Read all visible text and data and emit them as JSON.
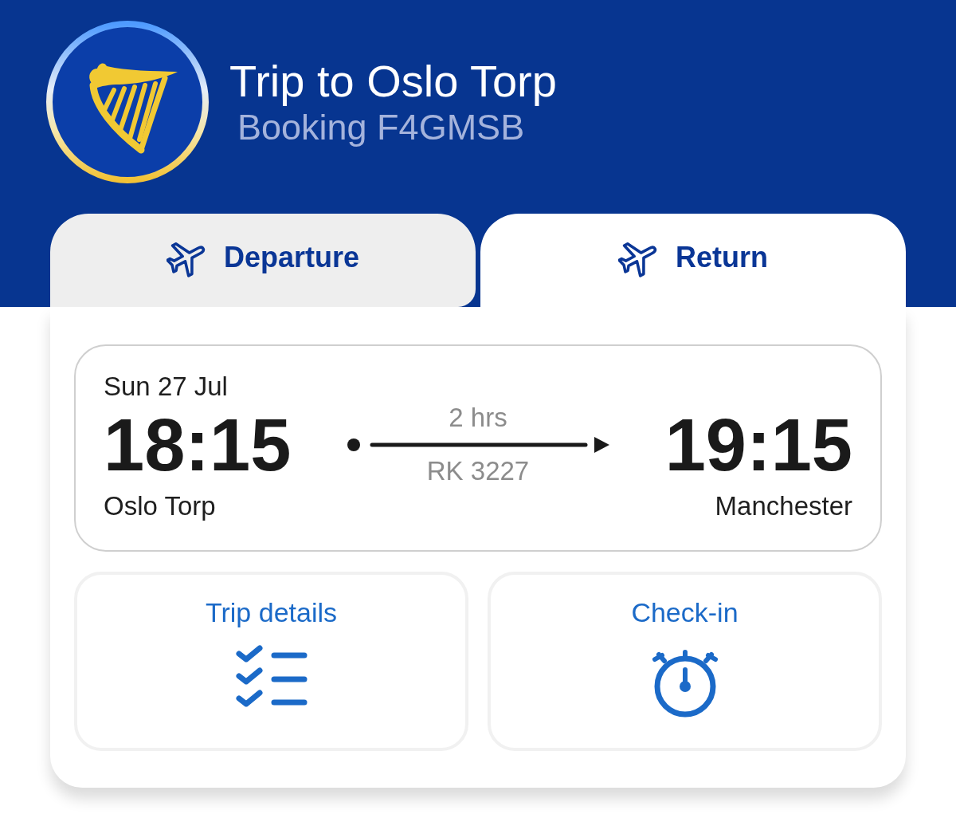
{
  "header": {
    "title": "Trip to Oslo Torp",
    "subtitle": "Booking F4GMSB"
  },
  "tabs": [
    {
      "label": "Departure",
      "selected": false
    },
    {
      "label": "Return",
      "selected": true
    }
  ],
  "flight": {
    "date": "Sun 27 Jul",
    "departure_time": "18:15",
    "duration": "2 hrs",
    "flight_number": "RK 3227",
    "arrival_time": "19:15",
    "departure_airport": "Oslo Torp",
    "arrival_airport": "Manchester"
  },
  "actions": [
    {
      "label": "Trip details",
      "kind": "checklist"
    },
    {
      "label": "Check-in",
      "kind": "stopwatch"
    }
  ]
}
